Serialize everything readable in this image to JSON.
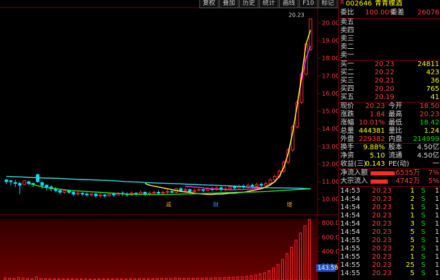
{
  "toolbar": {
    "buttons": [
      "复权",
      "叠加",
      "历史",
      "统计",
      "画线",
      "F10",
      "标记",
      "+自选",
      "返回"
    ]
  },
  "stock": {
    "code": "002646",
    "name": "青青稞酒"
  },
  "ratio": {
    "wb_label": "委比",
    "wb_value": "100.00%",
    "wc_label": "委差",
    "wc_value": "26076"
  },
  "sells": [
    {
      "label": "卖五",
      "price": "",
      "vol": ""
    },
    {
      "label": "卖四",
      "price": "",
      "vol": ""
    },
    {
      "label": "卖三",
      "price": "",
      "vol": ""
    },
    {
      "label": "卖二",
      "price": "",
      "vol": ""
    },
    {
      "label": "卖一",
      "price": "",
      "vol": ""
    }
  ],
  "buys": [
    {
      "label": "买一",
      "price": "20.23",
      "vol": "24811"
    },
    {
      "label": "买二",
      "price": "20.22",
      "vol": "423"
    },
    {
      "label": "买三",
      "price": "20.21",
      "vol": "36"
    },
    {
      "label": "买四",
      "price": "20.20",
      "vol": "765"
    },
    {
      "label": "买五",
      "price": "20.19",
      "vol": "41"
    }
  ],
  "quote": [
    {
      "l1": "现价",
      "v1": "20.23",
      "l2": "今开",
      "v2": "18.50"
    },
    {
      "l1": "涨跌",
      "v1": "1.84",
      "l2": "最高",
      "v2": "20.23"
    },
    {
      "l1": "涨幅",
      "v1": "10.01%",
      "l2": "最低",
      "v2": "18.42"
    },
    {
      "l1": "总量",
      "v1": "444381",
      "l2": "量比",
      "v2": "1.24"
    },
    {
      "l1": "外盘",
      "v1": "229382",
      "l2": "内盘",
      "v2": "214999"
    }
  ],
  "info": [
    {
      "l1": "换手",
      "v1": "9.88%",
      "l2": "股本",
      "v2": "4.50亿"
    },
    {
      "l1": "净资",
      "v1": "5.10",
      "l2": "流通",
      "v2": "4.50亿"
    },
    {
      "l1": "收益(三)",
      "v1": "0.143",
      "l2": "PE(动)",
      "v2": "一"
    }
  ],
  "flows": [
    {
      "label": "净流入额",
      "value": "6535万",
      "pct": "7%",
      "bar_fraction": 0.7
    },
    {
      "label": "大宗流入",
      "value": "4742万",
      "pct": "5%",
      "bar_fraction": 0.5
    }
  ],
  "ticks": [
    {
      "time": "14:53",
      "price": "20.23",
      "vol": "1",
      "dir": "S",
      "n": "1"
    },
    {
      "time": "14:54",
      "price": "20.23",
      "vol": "2",
      "dir": "S",
      "n": "1"
    },
    {
      "time": "14:54",
      "price": "20.23",
      "vol": "1",
      "dir": "S",
      "n": "1"
    },
    {
      "time": "14:54",
      "price": "20.23",
      "vol": "1",
      "dir": "S",
      "n": "1"
    },
    {
      "time": "14:54",
      "price": "20.23",
      "vol": "3",
      "dir": "S",
      "n": "1"
    },
    {
      "time": "14:54",
      "price": "20.23",
      "vol": "5",
      "dir": "S",
      "n": "1"
    },
    {
      "time": "14:55",
      "price": "20.23",
      "vol": "5",
      "dir": "S",
      "n": "1"
    },
    {
      "time": "14:55",
      "price": "20.23",
      "vol": "2",
      "dir": "S",
      "n": "1"
    },
    {
      "time": "14:55",
      "price": "20.23",
      "vol": "1",
      "dir": "S",
      "n": "1"
    },
    {
      "time": "14:55",
      "price": "20.23",
      "vol": "25",
      "dir": "S",
      "n": "1"
    },
    {
      "time": "14:55",
      "price": "20.23",
      "vol": "5",
      "dir": "S",
      "n": "1"
    }
  ],
  "markers": {
    "m1": "减",
    "m2": "财",
    "m3": "增"
  },
  "chart_data": {
    "type": "candlestick",
    "last_label": "20.23",
    "price_axis": [
      "20.00",
      "19.00",
      "18.00",
      "17.00",
      "16.00",
      "15.00",
      "14.00",
      "13.00",
      "12.00",
      "11.00",
      "10.00"
    ],
    "vol_axis": [
      "800.0",
      "600.0",
      "400.0",
      "200.0"
    ],
    "vol_readout": "143.58",
    "ylim": [
      9.6,
      20.6
    ],
    "vol_ylim": [
      0,
      860
    ],
    "candles": [
      [
        11.1,
        11.0,
        11.15,
        10.85
      ],
      [
        11.05,
        11.0,
        11.1,
        10.8
      ],
      [
        10.95,
        10.9,
        11.1,
        10.7
      ],
      [
        10.9,
        10.8,
        11.0,
        10.3
      ],
      [
        10.85,
        11.05,
        11.1,
        10.8
      ],
      [
        11.0,
        10.9,
        11.05,
        10.8
      ],
      [
        10.9,
        10.85,
        10.95,
        10.7
      ],
      [
        11.4,
        11.0,
        11.45,
        10.95
      ],
      [
        10.95,
        10.8,
        11.0,
        10.6
      ],
      [
        10.8,
        10.7,
        10.85,
        10.5
      ],
      [
        10.7,
        10.6,
        10.8,
        10.45
      ],
      [
        10.6,
        10.5,
        10.7,
        10.4
      ],
      [
        10.5,
        10.4,
        10.6,
        10.3
      ],
      [
        10.4,
        10.5,
        10.55,
        10.3
      ],
      [
        10.5,
        10.4,
        10.55,
        10.3
      ],
      [
        10.4,
        10.3,
        10.5,
        10.2
      ],
      [
        10.3,
        10.35,
        10.45,
        10.2
      ],
      [
        10.35,
        10.3,
        10.4,
        10.2
      ],
      [
        10.3,
        10.25,
        10.4,
        10.15
      ],
      [
        10.25,
        10.3,
        10.35,
        10.15
      ],
      [
        10.3,
        10.2,
        10.35,
        10.1
      ],
      [
        10.2,
        10.25,
        10.35,
        10.1
      ],
      [
        10.25,
        10.2,
        10.3,
        10.1
      ],
      [
        10.2,
        10.3,
        10.35,
        10.15
      ],
      [
        10.3,
        10.25,
        10.4,
        10.15
      ],
      [
        10.25,
        10.35,
        10.4,
        10.2
      ],
      [
        10.35,
        10.3,
        10.45,
        10.2
      ],
      [
        10.3,
        10.25,
        10.4,
        10.15
      ],
      [
        10.25,
        10.35,
        10.45,
        10.2
      ],
      [
        10.35,
        10.3,
        10.4,
        10.2
      ],
      [
        10.3,
        10.4,
        10.5,
        10.25
      ],
      [
        10.4,
        10.3,
        10.45,
        10.2
      ],
      [
        10.3,
        10.35,
        10.45,
        10.2
      ],
      [
        10.35,
        10.4,
        10.5,
        10.3
      ],
      [
        10.4,
        10.35,
        10.5,
        10.3
      ],
      [
        10.35,
        10.4,
        10.5,
        10.25
      ],
      [
        10.4,
        10.45,
        10.55,
        10.3
      ],
      [
        10.45,
        10.4,
        10.55,
        10.35
      ],
      [
        10.4,
        10.6,
        10.65,
        10.35
      ],
      [
        10.6,
        10.5,
        10.7,
        10.4
      ],
      [
        10.5,
        10.55,
        10.65,
        10.4
      ],
      [
        10.55,
        10.45,
        10.6,
        10.35
      ],
      [
        10.45,
        10.5,
        10.6,
        10.4
      ],
      [
        10.5,
        10.55,
        10.65,
        10.45
      ],
      [
        10.55,
        10.5,
        10.6,
        10.4
      ],
      [
        10.5,
        10.6,
        10.7,
        10.45
      ],
      [
        10.6,
        10.55,
        10.7,
        10.45
      ],
      [
        10.55,
        10.65,
        10.75,
        10.5
      ],
      [
        10.65,
        10.55,
        10.75,
        10.45
      ],
      [
        10.55,
        10.6,
        10.7,
        10.45
      ],
      [
        10.6,
        10.7,
        10.8,
        10.55
      ],
      [
        10.7,
        10.65,
        10.8,
        10.55
      ],
      [
        10.65,
        10.75,
        10.85,
        10.6
      ],
      [
        10.75,
        10.7,
        10.85,
        10.6
      ],
      [
        10.7,
        10.8,
        10.9,
        10.65
      ],
      [
        10.8,
        10.75,
        10.9,
        10.65
      ],
      [
        10.75,
        10.85,
        10.95,
        10.7
      ],
      [
        10.85,
        10.8,
        10.95,
        10.7
      ],
      [
        10.8,
        10.9,
        11.0,
        10.75
      ],
      [
        10.9,
        11.1,
        11.2,
        10.85
      ],
      [
        11.1,
        11.3,
        11.4,
        11.0
      ],
      [
        11.3,
        11.6,
        11.7,
        11.2
      ],
      [
        11.6,
        12.1,
        12.2,
        11.5
      ],
      [
        12.1,
        12.8,
        12.9,
        12.0
      ],
      [
        12.8,
        14.1,
        14.2,
        12.7
      ],
      [
        14.1,
        15.5,
        15.6,
        14.0
      ],
      [
        15.5,
        17.1,
        17.2,
        15.4
      ],
      [
        17.1,
        18.8,
        18.9,
        17.0
      ],
      [
        18.5,
        20.23,
        20.23,
        18.42
      ]
    ],
    "ma_short": [
      10.9,
      10.8,
      10.75,
      10.7,
      10.65,
      10.6,
      10.55,
      10.5,
      10.45,
      10.42,
      10.4,
      10.35,
      10.32,
      10.3,
      10.28,
      10.28,
      10.3,
      10.3,
      10.32,
      10.35,
      10.35,
      10.38,
      10.4,
      10.45,
      10.5,
      10.55,
      10.6,
      10.7,
      10.85,
      11.0,
      11.3,
      11.8,
      12.6,
      13.8,
      15.3,
      17.0,
      18.8,
      19.6
    ],
    "ma_mid": [
      11.3,
      11.28,
      11.25,
      11.22,
      11.2,
      11.18,
      11.15,
      11.12,
      11.1,
      11.08,
      11.05,
      11.0,
      10.98,
      10.95,
      10.92,
      10.9,
      10.88,
      10.85,
      10.82,
      10.8,
      10.78,
      10.75,
      10.7,
      10.68,
      10.66,
      10.65,
      10.64,
      10.63,
      10.6
    ],
    "ma_long": [
      10.75,
      10.72,
      10.7,
      10.68,
      10.65,
      10.62,
      10.6,
      10.58,
      10.56,
      10.55,
      10.54,
      10.54,
      10.55,
      10.56,
      10.58,
      10.6,
      10.62,
      10.65,
      10.7,
      10.8,
      11.0,
      11.3,
      11.8,
      12.6,
      13.8,
      15.3,
      16.8,
      18.0,
      18.7
    ],
    "volume": [
      30,
      25,
      22,
      35,
      28,
      20,
      18,
      40,
      22,
      20,
      18,
      17,
      16,
      15,
      18,
      16,
      15,
      14,
      16,
      15,
      14,
      15,
      16,
      17,
      16,
      18,
      17,
      16,
      18,
      17,
      20,
      19,
      18,
      20,
      22,
      21,
      23,
      22,
      28,
      25,
      24,
      26,
      25,
      27,
      26,
      30,
      29,
      32,
      31,
      33,
      36,
      38,
      42,
      46,
      52,
      60,
      70,
      85,
      100,
      130,
      170,
      220,
      290,
      370,
      460,
      560,
      660,
      760,
      850
    ]
  }
}
